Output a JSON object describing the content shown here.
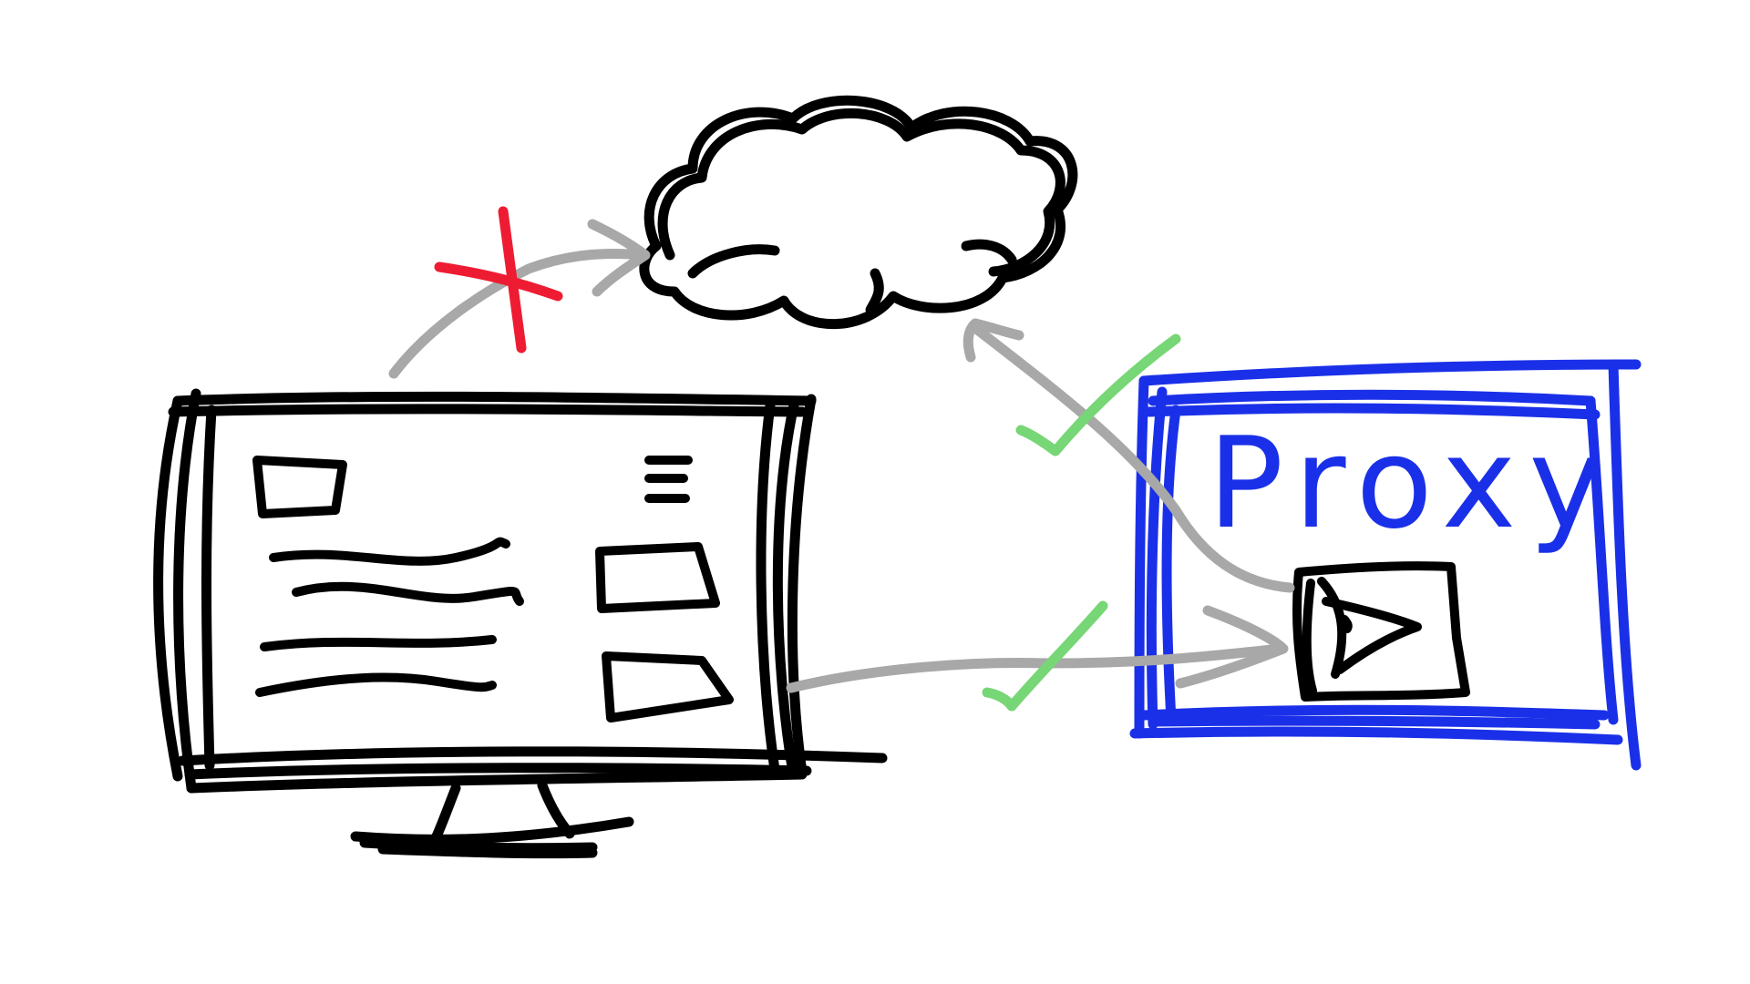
{
  "proxy": {
    "label": "Proxy"
  },
  "colors": {
    "ink": "#000000",
    "proxy": "#1a30e8",
    "arrow": "#a8a8a8",
    "blocked": "#ee1c33",
    "allowed": "#77d675",
    "background": "#ffffff"
  },
  "connections": [
    {
      "from": "computer",
      "to": "cloud",
      "status": "blocked",
      "mark": "red-cross"
    },
    {
      "from": "proxy",
      "to": "cloud",
      "status": "allowed",
      "mark": "green-check"
    },
    {
      "from": "computer",
      "to": "proxy",
      "status": "allowed",
      "mark": "green-check"
    }
  ]
}
